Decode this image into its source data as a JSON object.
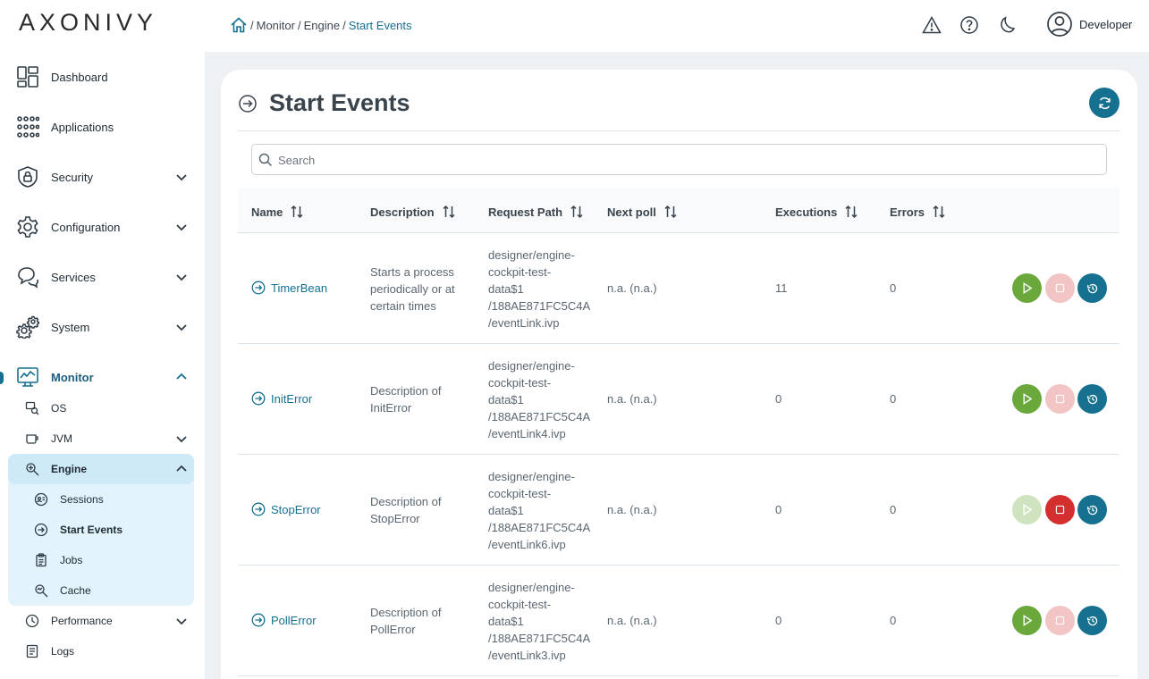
{
  "app": {
    "logo": "AXONIVY"
  },
  "sidebar": {
    "items": [
      {
        "label": "Dashboard",
        "icon": "dashboard-icon"
      },
      {
        "label": "Applications",
        "icon": "apps-grid-icon"
      },
      {
        "label": "Security",
        "icon": "shield-lock-icon"
      },
      {
        "label": "Configuration",
        "icon": "gear-icon"
      },
      {
        "label": "Services",
        "icon": "chat-bubbles-icon"
      },
      {
        "label": "System",
        "icon": "gears-icon"
      },
      {
        "label": "Monitor",
        "icon": "monitor-chart-icon"
      }
    ],
    "monitor_children": [
      {
        "label": "OS",
        "icon": "os-search-icon"
      },
      {
        "label": "JVM",
        "icon": "coffee-cup-icon"
      },
      {
        "label": "Engine",
        "icon": "engine-search-icon"
      },
      {
        "label": "Performance",
        "icon": "clock-icon"
      },
      {
        "label": "Logs",
        "icon": "document-icon"
      }
    ],
    "engine_children": [
      {
        "label": "Sessions",
        "icon": "sessions-icon"
      },
      {
        "label": "Start Events",
        "icon": "arrow-circle-icon"
      },
      {
        "label": "Jobs",
        "icon": "clipboard-icon"
      },
      {
        "label": "Cache",
        "icon": "cache-search-icon"
      }
    ]
  },
  "topbar": {
    "breadcrumb": [
      "Monitor",
      "Engine",
      "Start Events"
    ],
    "user": "Developer"
  },
  "page": {
    "title": "Start Events",
    "search_placeholder": "Search"
  },
  "table": {
    "columns": [
      "Name",
      "Description",
      "Request Path",
      "Next poll",
      "Executions",
      "Errors"
    ],
    "rows": [
      {
        "name": "TimerBean",
        "description": [
          "Starts a process",
          "periodically or at",
          "certain times"
        ],
        "path": [
          "designer/engine-",
          "cockpit-test-",
          "data$1",
          "/188AE871FC5C4A",
          "/eventLink.ivp"
        ],
        "next_poll": "n.a. (n.a.)",
        "executions": "11",
        "errors": "0",
        "start_enabled": true,
        "stop_enabled": false
      },
      {
        "name": "InitError",
        "description": [
          "Description of",
          "InitError"
        ],
        "path": [
          "designer/engine-",
          "cockpit-test-",
          "data$1",
          "/188AE871FC5C4A",
          "/eventLink4.ivp"
        ],
        "next_poll": "n.a. (n.a.)",
        "executions": "0",
        "errors": "0",
        "start_enabled": true,
        "stop_enabled": false
      },
      {
        "name": "StopError",
        "description": [
          "Description of",
          "StopError"
        ],
        "path": [
          "designer/engine-",
          "cockpit-test-",
          "data$1",
          "/188AE871FC5C4A",
          "/eventLink6.ivp"
        ],
        "next_poll": "n.a. (n.a.)",
        "executions": "0",
        "errors": "0",
        "start_enabled": false,
        "stop_enabled": true
      },
      {
        "name": "PollError",
        "description": [
          "Description of",
          "PollError"
        ],
        "path": [
          "designer/engine-",
          "cockpit-test-",
          "data$1",
          "/188AE871FC5C4A",
          "/eventLink3.ivp"
        ],
        "next_poll": "n.a. (n.a.)",
        "executions": "0",
        "errors": "0",
        "start_enabled": true,
        "stop_enabled": false
      }
    ]
  },
  "colors": {
    "accent": "#16708f",
    "start": "#6aa83b",
    "stop": "#d32f2f"
  }
}
